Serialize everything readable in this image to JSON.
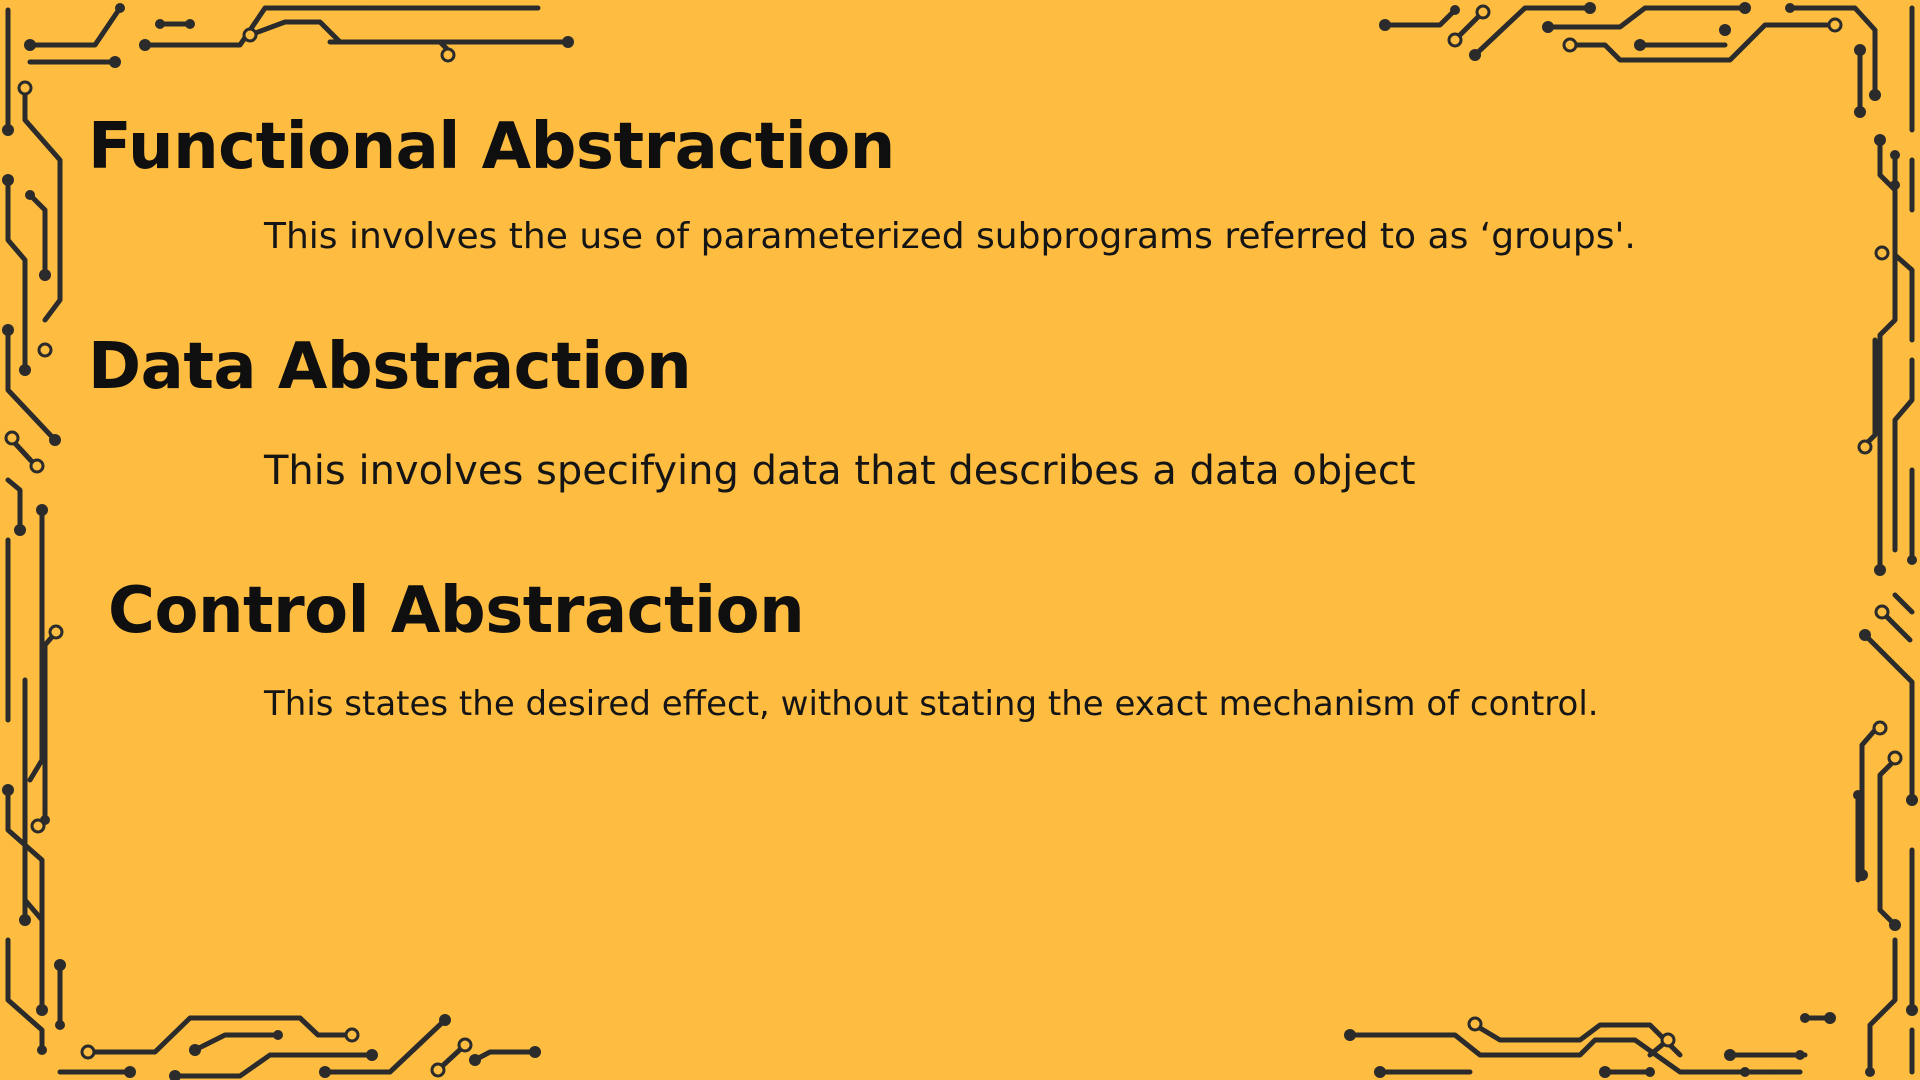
{
  "sections": [
    {
      "heading": "Functional Abstraction",
      "description": "This involves the use of parameterized subprograms referred to as ‘groups'."
    },
    {
      "heading": "Data Abstraction",
      "description": "This involves specifying data that describes a data object"
    },
    {
      "heading": "Control Abstraction",
      "description": "This states the desired effect, without stating the exact mechanism of control."
    }
  ],
  "colors": {
    "background": "#FEBD40",
    "circuit": "#2b2b2b",
    "text": "#0f0f0f"
  }
}
